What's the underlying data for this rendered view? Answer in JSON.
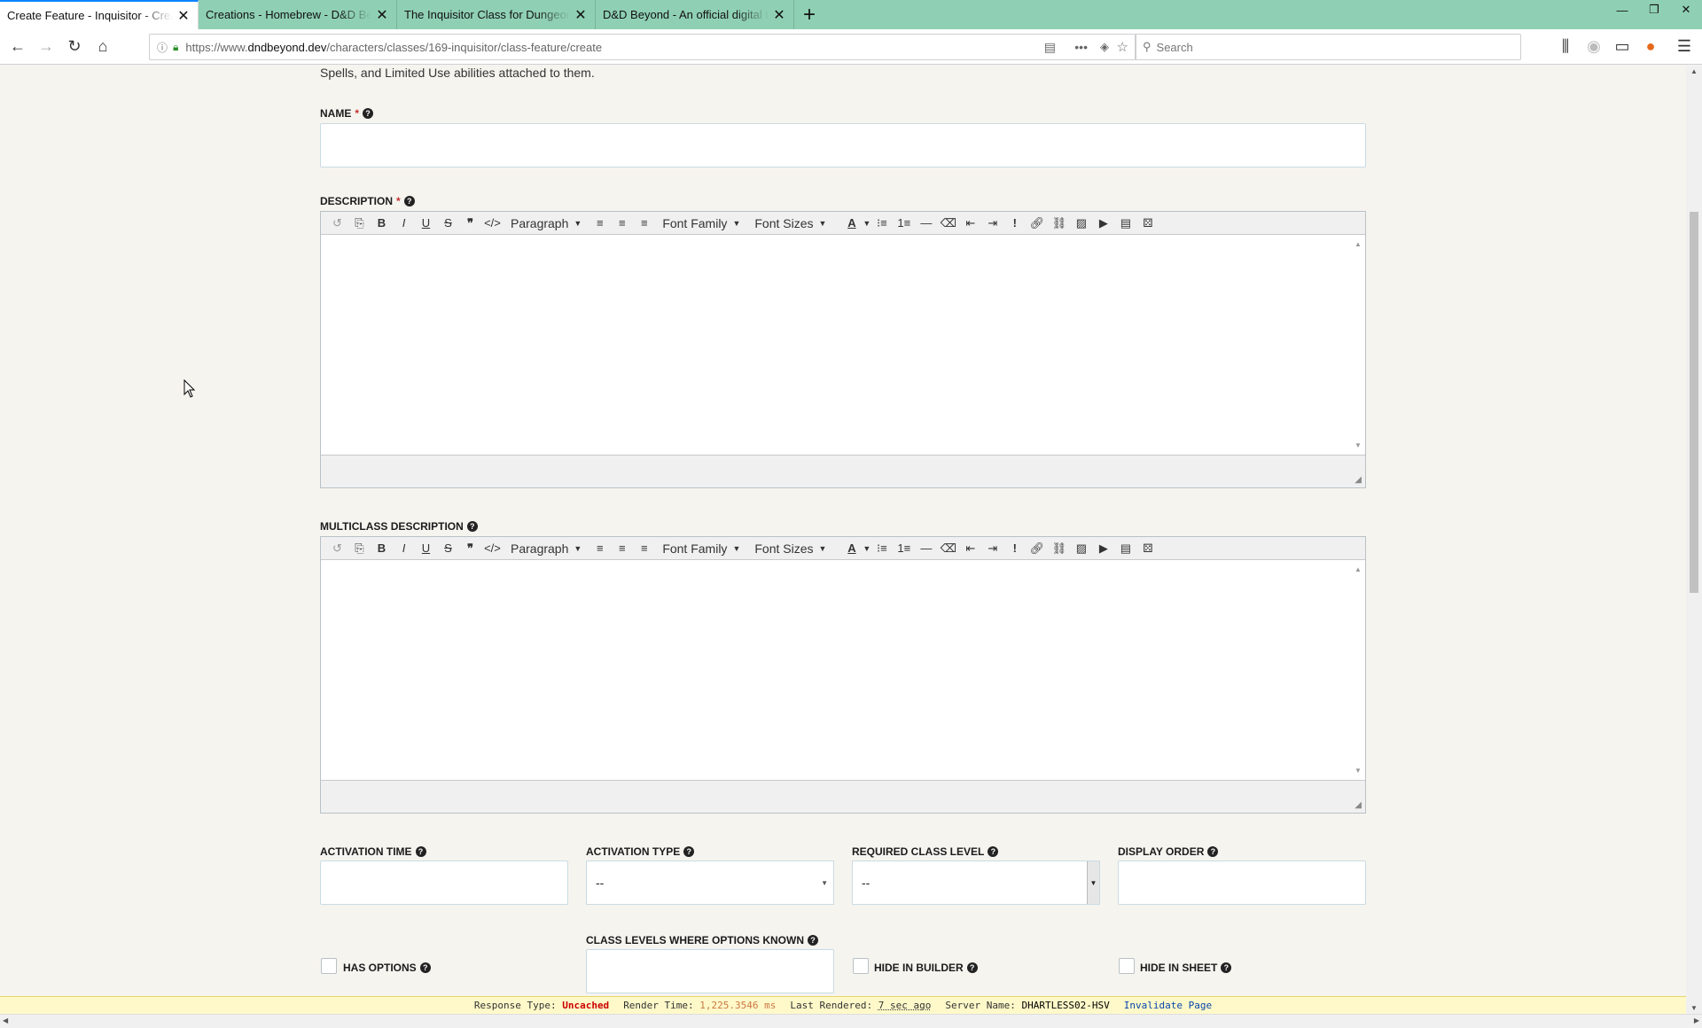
{
  "browser": {
    "tabs": [
      {
        "label": "Create Feature - Inquisitor - Creatio",
        "active": true
      },
      {
        "label": "Creations - Homebrew - D&D Beyo",
        "active": false
      },
      {
        "label": "The Inquisitor Class for Dungeons &",
        "active": false
      },
      {
        "label": "D&D Beyond - An official digital to",
        "active": false
      }
    ],
    "new_tab_icon": "plus-icon",
    "url_prefix": "https://www.",
    "url_host": "dndbeyond.dev",
    "url_path": "/characters/classes/169-inquisitor/class-feature/create",
    "search_placeholder": "Search",
    "accent_color": "#8fd0b4"
  },
  "page": {
    "intro_text": "Spells, and Limited Use abilities attached to them.",
    "name_label": "NAME",
    "required_marker": "*",
    "description_label": "DESCRIPTION",
    "multiclass_label": "MULTICLASS DESCRIPTION",
    "editor": {
      "paragraph": "Paragraph",
      "font_family": "Font Family",
      "font_sizes": "Font Sizes"
    },
    "activation_time_label": "ACTIVATION TIME",
    "activation_type_label": "ACTIVATION TYPE",
    "activation_type_value": "--",
    "required_level_label": "REQUIRED CLASS LEVEL",
    "required_level_value": "--",
    "display_order_label": "DISPLAY ORDER",
    "class_levels_label": "CLASS LEVELS WHERE OPTIONS KNOWN",
    "has_options_label": "HAS OPTIONS",
    "hide_builder_label": "HIDE IN BUILDER",
    "hide_sheet_label": "HIDE IN SHEET"
  },
  "devbar": {
    "response_label": "Response Type:",
    "response_value": "Uncached",
    "render_label": "Render Time:",
    "render_value": "1,225.3546 ms",
    "last_label": "Last Rendered:",
    "last_value": "7 sec ago",
    "server_label": "Server Name:",
    "server_value": "DHARTLESS02-HSV",
    "invalidate": "Invalidate Page"
  }
}
